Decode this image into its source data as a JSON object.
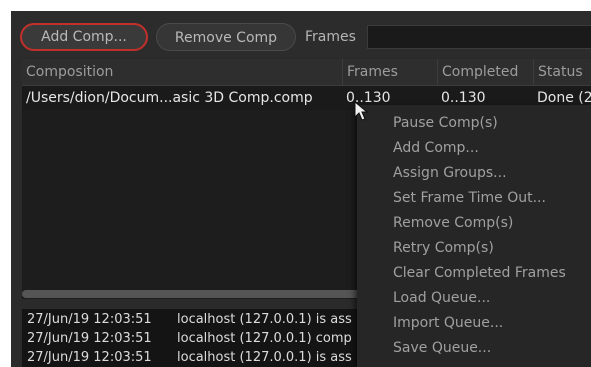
{
  "toolbar": {
    "add_comp_label": "Add Comp...",
    "remove_comp_label": "Remove Comp",
    "frames_label": "Frames",
    "frames_value": ""
  },
  "table": {
    "columns": [
      "Composition",
      "Frames",
      "Completed",
      "Status"
    ],
    "rows": [
      {
        "composition": "/Users/dion/Docum...asic 3D Comp.comp",
        "frames": "0..130",
        "completed": "0..130",
        "status": "Done (2"
      }
    ]
  },
  "log": [
    {
      "timestamp": "27/Jun/19 12:03:51",
      "message": "localhost (127.0.0.1) is ass"
    },
    {
      "timestamp": "27/Jun/19 12:03:51",
      "message": "localhost (127.0.0.1) comp"
    },
    {
      "timestamp": "27/Jun/19 12:03:51",
      "message": "localhost (127.0.0.1) is ass"
    }
  ],
  "context_menu": {
    "items": [
      "Pause Comp(s)",
      "Add Comp...",
      "Assign Groups...",
      "Set Frame Time Out...",
      "Remove Comp(s)",
      "Retry Comp(s)",
      "Clear Completed Frames",
      "Load Queue...",
      "Import Queue...",
      "Save Queue..."
    ]
  },
  "colors": {
    "accent_border": "#c1302a",
    "panel_bg": "#2b2b2b"
  }
}
